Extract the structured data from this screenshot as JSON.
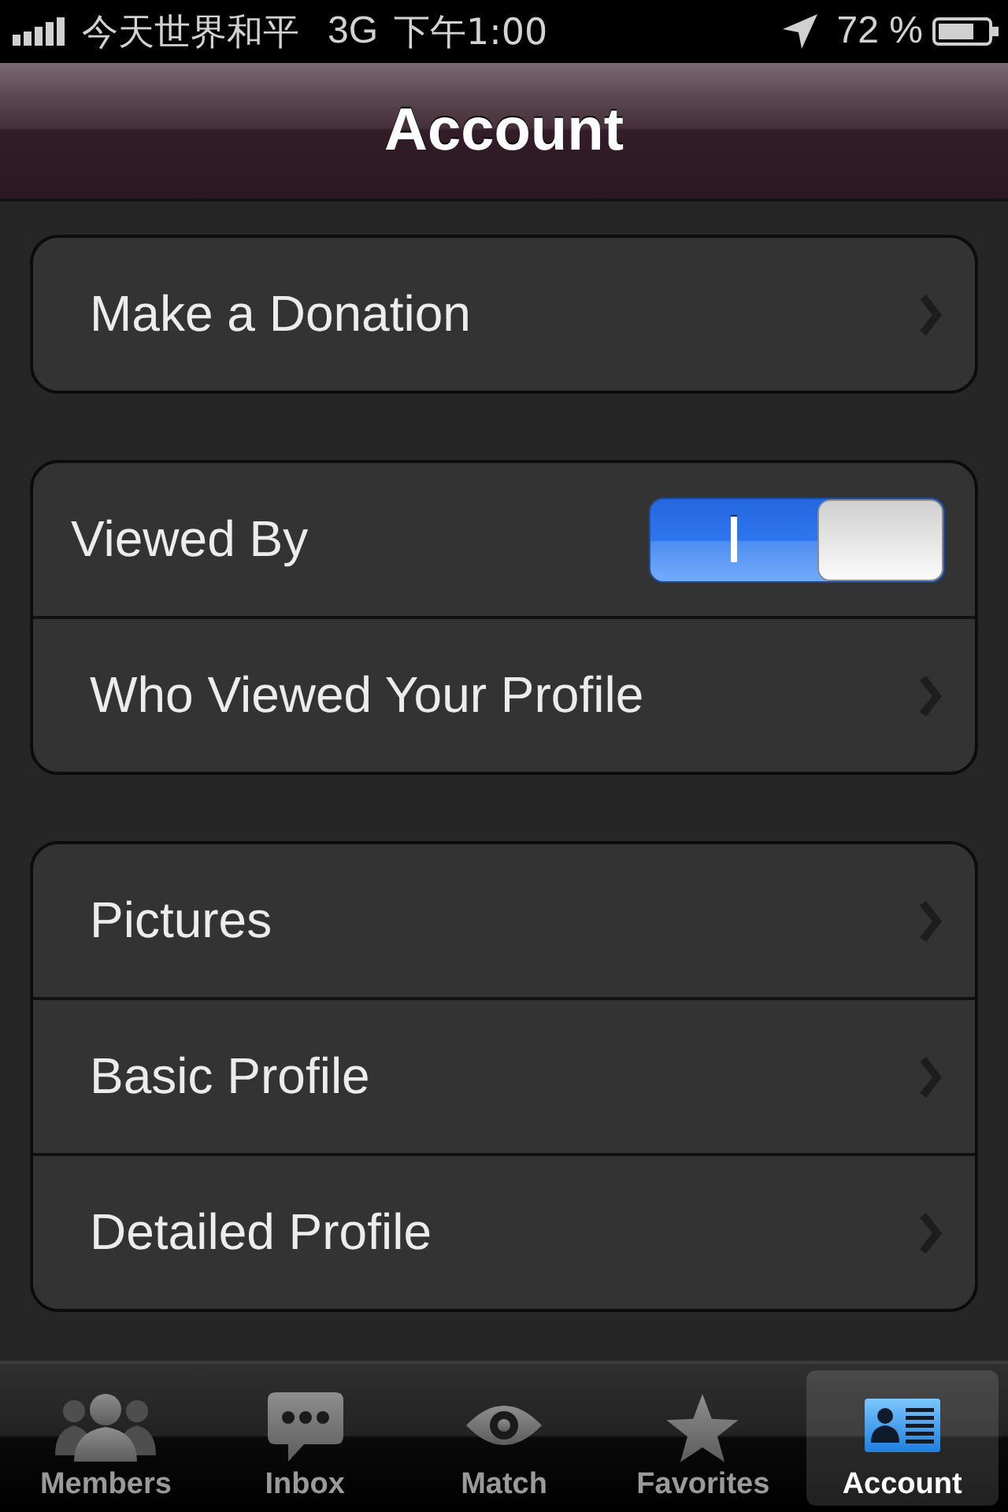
{
  "status_bar": {
    "carrier": "今天世界和平",
    "network": "3G",
    "time": "下午1:00",
    "battery": "72 %"
  },
  "nav_bar": {
    "title": "Account"
  },
  "groups": [
    {
      "rows": [
        {
          "kind": "link",
          "label": "Make a Donation"
        }
      ]
    },
    {
      "rows": [
        {
          "kind": "toggle",
          "label": "Viewed By",
          "on": true
        },
        {
          "kind": "link",
          "label": "Who Viewed Your Profile"
        }
      ]
    },
    {
      "rows": [
        {
          "kind": "link",
          "label": "Pictures"
        },
        {
          "kind": "link",
          "label": "Basic Profile"
        },
        {
          "kind": "link",
          "label": "Detailed Profile"
        }
      ]
    }
  ],
  "tab_bar": {
    "tabs": [
      {
        "label": "Members",
        "selected": false
      },
      {
        "label": "Inbox",
        "selected": false
      },
      {
        "label": "Match",
        "selected": false
      },
      {
        "label": "Favorites",
        "selected": false
      },
      {
        "label": "Account",
        "selected": true
      }
    ]
  }
}
